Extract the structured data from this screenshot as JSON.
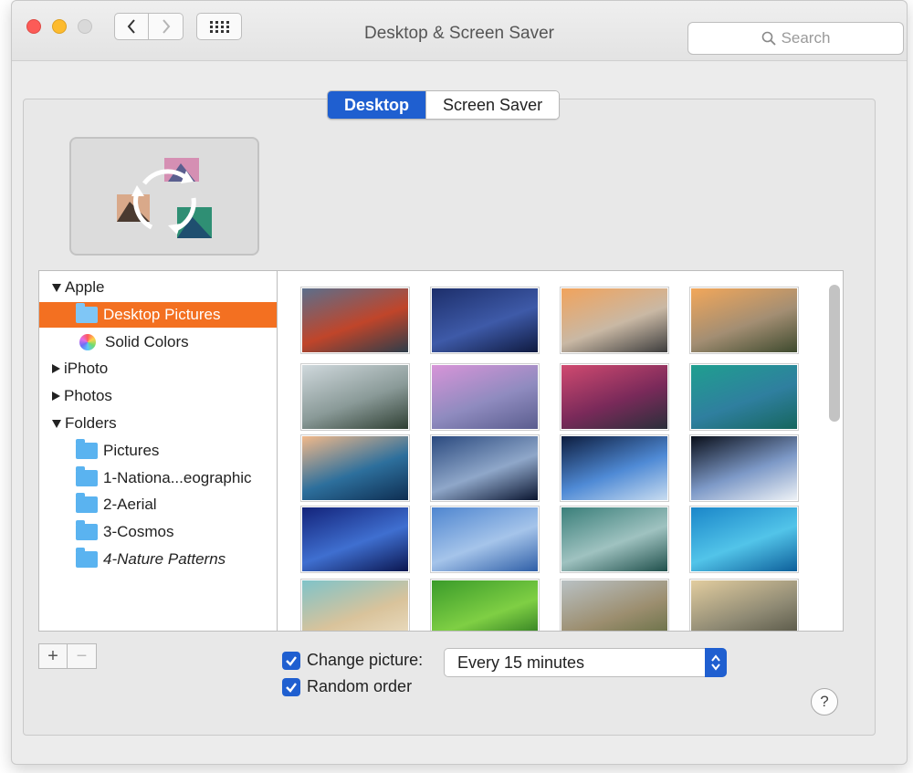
{
  "window": {
    "title": "Desktop & Screen Saver",
    "search_placeholder": "Search"
  },
  "tabs": [
    {
      "label": "Desktop",
      "active": true
    },
    {
      "label": "Screen Saver",
      "active": false
    }
  ],
  "sidebar": {
    "items": [
      {
        "label": "Apple",
        "type": "group",
        "expanded": true
      },
      {
        "label": "Desktop Pictures",
        "type": "folder",
        "selected": true
      },
      {
        "label": "Solid Colors",
        "type": "colors"
      },
      {
        "label": "iPhoto",
        "type": "group",
        "expanded": false
      },
      {
        "label": "Photos",
        "type": "group",
        "expanded": false
      },
      {
        "label": "Folders",
        "type": "group",
        "expanded": true
      },
      {
        "label": "Pictures",
        "type": "folder"
      },
      {
        "label": "1-Nationa...eographic",
        "type": "folder"
      },
      {
        "label": "2-Aerial",
        "type": "folder"
      },
      {
        "label": "3-Cosmos",
        "type": "folder"
      },
      {
        "label": "4-Nature Patterns",
        "type": "folder"
      }
    ]
  },
  "wallpapers": [
    {
      "name": "el-capitan",
      "c1": "#5b6f8c",
      "c2": "#c0452a",
      "c3": "#2e3d4a"
    },
    {
      "name": "yosemite-night",
      "c1": "#1d2f6b",
      "c2": "#3e5aa8",
      "c3": "#0f1a40"
    },
    {
      "name": "half-dome-sunset",
      "c1": "#f1a35c",
      "c2": "#c9b8a4",
      "c3": "#3d3d3d"
    },
    {
      "name": "el-capitan-dusk",
      "c1": "#f2a75a",
      "c2": "#a38e73",
      "c3": "#3e4a2e"
    },
    {
      "name": "yosemite-fog",
      "c1": "#cfd8dc",
      "c2": "#8a9a98",
      "c3": "#2f3f33"
    },
    {
      "name": "yosemite-pink",
      "c1": "#d794d8",
      "c2": "#8f8bbf",
      "c3": "#5a5d8e"
    },
    {
      "name": "lake-sunset",
      "c1": "#d04a70",
      "c2": "#7a2a5a",
      "c3": "#2a2f3a"
    },
    {
      "name": "mavericks-wave",
      "c1": "#1f9f8f",
      "c2": "#2f7f9f",
      "c3": "#16665e"
    },
    {
      "name": "mavericks",
      "c1": "#f2b98a",
      "c2": "#2d6f9c",
      "c3": "#0e2e52"
    },
    {
      "name": "galaxy",
      "c1": "#2b4a7f",
      "c2": "#8fa7c9",
      "c3": "#0a1530"
    },
    {
      "name": "earth-horizon",
      "c1": "#0d1d3f",
      "c2": "#4f8ad5",
      "c3": "#c8dcf0"
    },
    {
      "name": "earth-orbit",
      "c1": "#0a0f1a",
      "c2": "#7d99c7",
      "c3": "#eef2f6"
    },
    {
      "name": "blue-nebula",
      "c1": "#13237a",
      "c2": "#3f6fd0",
      "c3": "#0b1650"
    },
    {
      "name": "clouds-moon",
      "c1": "#4f86d0",
      "c2": "#a5c4ea",
      "c3": "#2f5fa7"
    },
    {
      "name": "teal-clouds",
      "c1": "#3a7f7a",
      "c2": "#9fc2c0",
      "c3": "#20504c"
    },
    {
      "name": "ocean-ripples",
      "c1": "#1a86c9",
      "c2": "#52c4e9",
      "c3": "#0d5f9a"
    },
    {
      "name": "beach",
      "c1": "#7fc3c9",
      "c2": "#d9c39b",
      "c3": "#ede1c7"
    },
    {
      "name": "green-fields",
      "c1": "#3a9b2a",
      "c2": "#7fcf44",
      "c3": "#1f6b1a"
    },
    {
      "name": "misty-forest",
      "c1": "#b9c1c4",
      "c2": "#9c8e6f",
      "c3": "#5d6a3e"
    },
    {
      "name": "sand-dunes",
      "c1": "#e2cd9f",
      "c2": "#8f8a74",
      "c3": "#4a4a3c"
    }
  ],
  "controls": {
    "add_label": "+",
    "remove_label": "−",
    "change_picture_label": "Change picture:",
    "change_picture_checked": true,
    "interval_value": "Every 15 minutes",
    "random_order_label": "Random order",
    "random_order_checked": true,
    "help_label": "?"
  },
  "colors": {
    "accent": "#1f5fd0",
    "selection": "#f37021",
    "folder": "#5ab3f0"
  }
}
